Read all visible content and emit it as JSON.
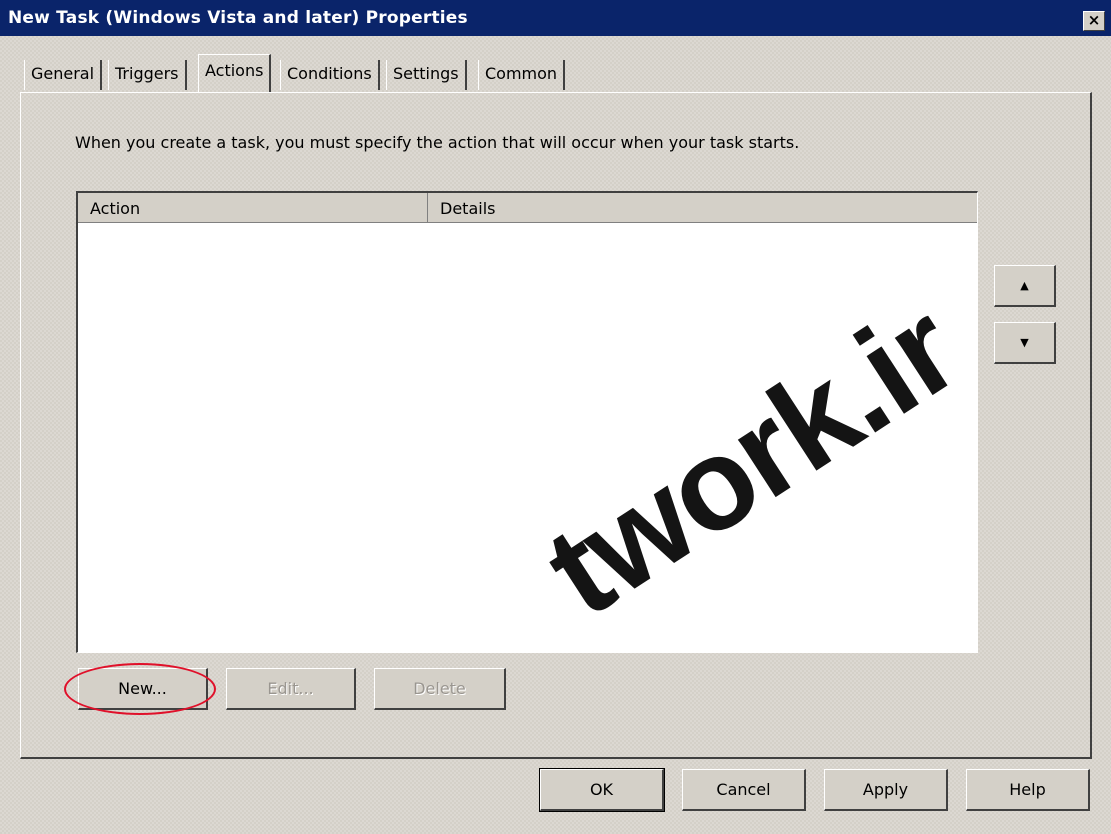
{
  "window": {
    "title": "New Task (Windows Vista and later) Properties",
    "close_label": "×"
  },
  "tabs": [
    {
      "label": "General",
      "active": false
    },
    {
      "label": "Triggers",
      "active": false
    },
    {
      "label": "Actions",
      "active": true
    },
    {
      "label": "Conditions",
      "active": false
    },
    {
      "label": "Settings",
      "active": false
    },
    {
      "label": "Common",
      "active": false
    }
  ],
  "actions_panel": {
    "intro_text": "When you create a task, you must specify the action that will occur when your task starts.",
    "columns": [
      "Action",
      "Details"
    ],
    "rows": [],
    "move_up_icon": "triangle-up",
    "move_down_icon": "triangle-down",
    "new_label": "New...",
    "edit_label": "Edit...",
    "delete_label": "Delete"
  },
  "footer": {
    "ok_label": "OK",
    "cancel_label": "Cancel",
    "apply_label": "Apply",
    "help_label": "Help"
  },
  "watermark_text": "twork.ir",
  "colors": {
    "titlebar": "#0a246a",
    "dialog_face": "#d4d0c8",
    "highlight_ring": "#e0102a"
  }
}
